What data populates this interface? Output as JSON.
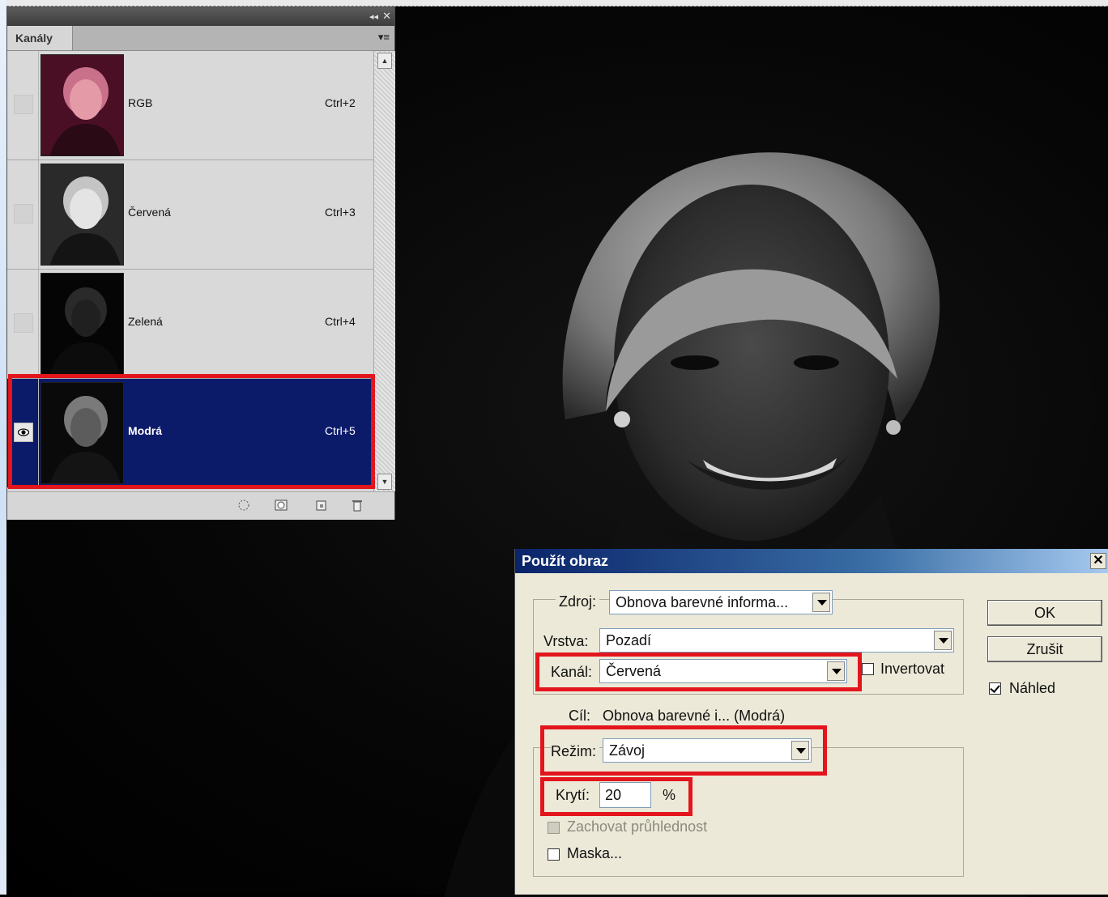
{
  "channels_panel": {
    "tab_label": "Kanály",
    "channels": [
      {
        "name": "RGB",
        "shortcut": "Ctrl+2",
        "visible": false,
        "selected": false
      },
      {
        "name": "Červená",
        "shortcut": "Ctrl+3",
        "visible": false,
        "selected": false
      },
      {
        "name": "Zelená",
        "shortcut": "Ctrl+4",
        "visible": false,
        "selected": false
      },
      {
        "name": "Modrá",
        "shortcut": "Ctrl+5",
        "visible": true,
        "selected": true
      }
    ]
  },
  "dialog": {
    "title": "Použít obraz",
    "source_label": "Zdroj:",
    "source_value": "Obnova barevné informa...",
    "layer_label": "Vrstva:",
    "layer_value": "Pozadí",
    "channel_label": "Kanál:",
    "channel_value": "Červená",
    "invert_label": "Invertovat",
    "invert_checked": false,
    "target_label": "Cíl:",
    "target_value": "Obnova barevné i... (Modrá)",
    "mode_label": "Režim:",
    "mode_value": "Závoj",
    "opacity_label": "Krytí:",
    "opacity_value": "20",
    "opacity_unit": "%",
    "preserve_label": "Zachovat průhlednost",
    "mask_label": "Maska...",
    "ok_label": "OK",
    "cancel_label": "Zrušit",
    "preview_label": "Náhled",
    "preview_checked": true
  },
  "colors": {
    "highlight": "#e3151d",
    "selection": "#0c1a6a",
    "dialog_title": "#0a246a"
  }
}
